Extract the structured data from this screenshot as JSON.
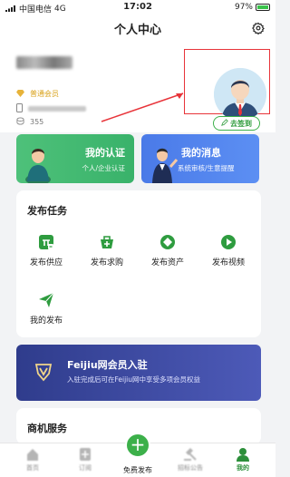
{
  "status_bar": {
    "carrier": "中国电信",
    "network": "4G",
    "time": "17:02",
    "battery": "97%"
  },
  "header": {
    "title": "个人中心"
  },
  "profile": {
    "member_level": "普通会员",
    "points": "355",
    "signin_label": "去签到"
  },
  "cards": [
    {
      "title": "我的认证",
      "subtitle": "个人/企业认证"
    },
    {
      "title": "我的消息",
      "subtitle": "系统审核/生意提醒"
    }
  ],
  "publish_tasks": {
    "title": "发布任务",
    "items": [
      {
        "label": "发布供应"
      },
      {
        "label": "发布求购"
      },
      {
        "label": "发布资产"
      },
      {
        "label": "发布视频"
      },
      {
        "label": "我的发布"
      }
    ]
  },
  "vip_banner": {
    "title": "Feijiu网会员入驻",
    "subtitle": "入驻完成后可在Feijiu网中享受多项会员权益"
  },
  "business": {
    "title": "商机服务"
  },
  "tabbar": {
    "items": [
      {
        "label": "首页"
      },
      {
        "label": "订阅"
      },
      {
        "label": "免费发布"
      },
      {
        "label": "招标公告"
      },
      {
        "label": "我的"
      }
    ]
  },
  "colors": {
    "brand_green": "#3cb04a",
    "highlight_red": "#e8343a",
    "vip_blue": "#3a4aa6"
  }
}
